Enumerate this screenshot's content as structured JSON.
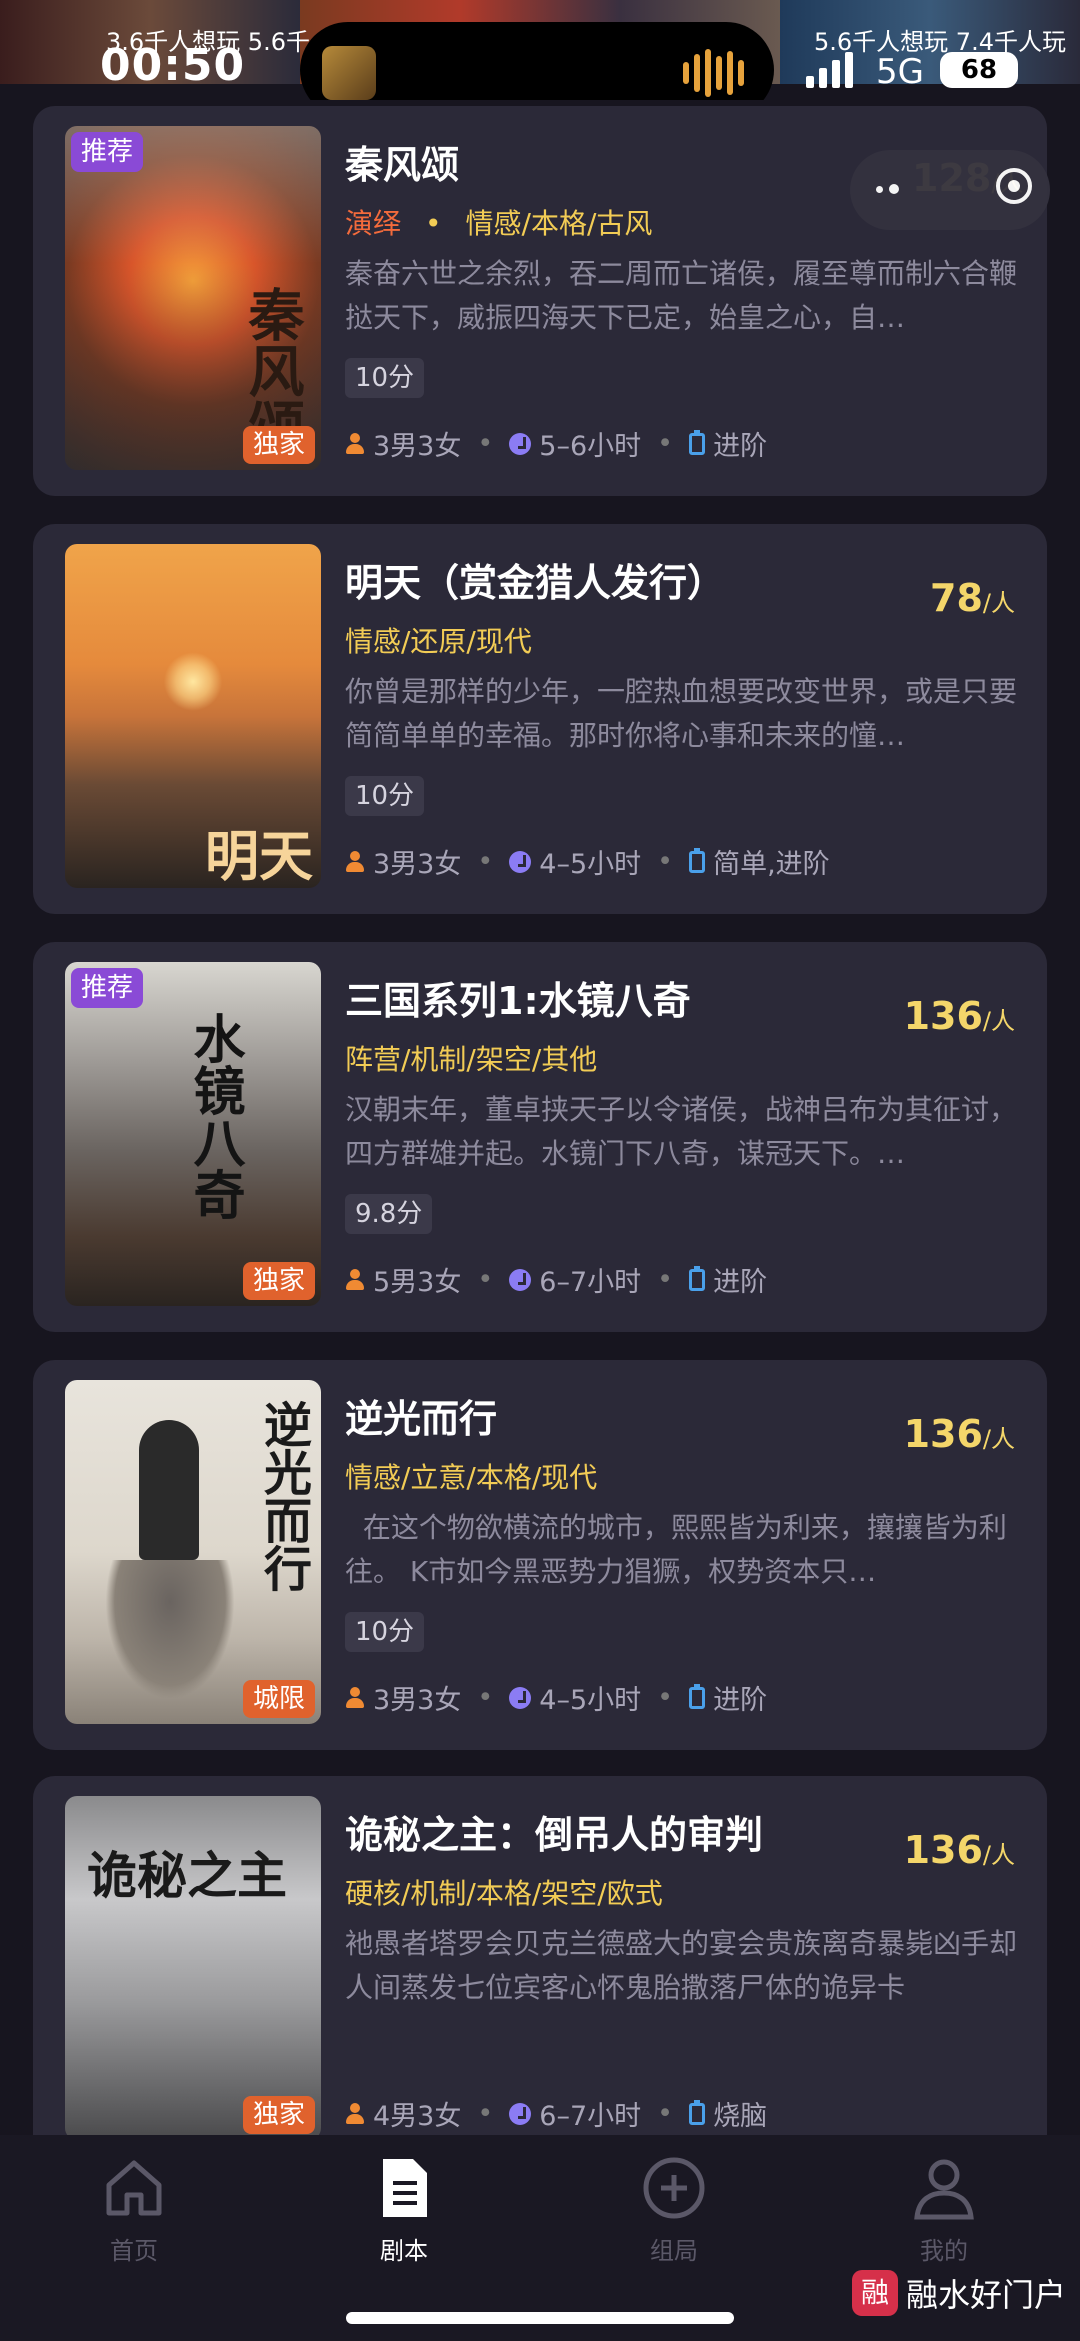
{
  "status": {
    "strip_texts": [
      "3.6千人想玩 5.6千",
      "5.6千人想玩 7.4千人玩"
    ],
    "time": "00:50",
    "network": "5G",
    "battery": "68"
  },
  "cards": [
    {
      "title": "秦风颂",
      "price": "128",
      "price_unit": "/人",
      "type": "演绎",
      "genres": "情感/本格/古风",
      "description": "秦奋六世之余烈，吞二周而亡诸侯，履至尊而制六合鞭挞天下，威振四海天下已定，始皇之心，自…",
      "score": "10分",
      "players": "3男3女",
      "duration": "5–6小时",
      "difficulty": "进阶",
      "badge_top": "推荐",
      "badge_bottom": "独家",
      "cover_title": "秦风颂"
    },
    {
      "title": "明天（赏金猎人发行）",
      "price": "78",
      "price_unit": "/人",
      "type": "",
      "genres": "情感/还原/现代",
      "description": "你曾是那样的少年，一腔热血想要改变世界，或是只要简简单单的幸福。那时你将心事和未来的憧…",
      "score": "10分",
      "players": "3男3女",
      "duration": "4–5小时",
      "difficulty": "简单,进阶",
      "badge_top": "",
      "badge_bottom": "",
      "cover_title": "明天"
    },
    {
      "title": "三国系列1:水镜八奇",
      "price": "136",
      "price_unit": "/人",
      "type": "",
      "genres": "阵营/机制/架空/其他",
      "description": "汉朝末年，董卓挟天子以令诸侯，战神吕布为其征讨，四方群雄并起。水镜门下八奇，谋冠天下。…",
      "score": "9.8分",
      "players": "5男3女",
      "duration": "6–7小时",
      "difficulty": "进阶",
      "badge_top": "推荐",
      "badge_bottom": "独家",
      "cover_title": "水镜八奇"
    },
    {
      "title": "逆光而行",
      "price": "136",
      "price_unit": "/人",
      "type": "",
      "genres": "情感/立意/本格/现代",
      "description": "  在这个物欲横流的城市，熙熙皆为利来，攘攘皆为利往。 K市如今黑恶势力猖獗，权势资本只…",
      "score": "10分",
      "players": "3男3女",
      "duration": "4–5小时",
      "difficulty": "进阶",
      "badge_top": "",
      "badge_bottom": "城限",
      "cover_title": "逆光而行"
    },
    {
      "title": "诡秘之主：倒吊人的审判",
      "price": "136",
      "price_unit": "/人",
      "type": "",
      "genres": "硬核/机制/本格/架空/欧式",
      "description": "衪愚者塔罗会贝克兰德盛大的宴会贵族离奇暴毙凶手却人间蒸发七位宾客心怀鬼胎撒落尸体的诡异卡",
      "score": "",
      "players": "4男3女",
      "duration": "6–7小时",
      "difficulty": "烧脑",
      "badge_top": "",
      "badge_bottom": "独家",
      "cover_title": "诡秘之主"
    }
  ],
  "tabs": [
    {
      "label": "首页",
      "icon": "home-icon"
    },
    {
      "label": "剧本",
      "icon": "script-icon"
    },
    {
      "label": "组局",
      "icon": "add-circle-icon"
    },
    {
      "label": "我的",
      "icon": "profile-icon"
    }
  ],
  "watermark": {
    "logo": "融",
    "text": "融水好门户"
  },
  "colors": {
    "background": "#17151f",
    "card": "#2b2938",
    "price": "#f4d66a",
    "genre": "#f2cc55",
    "type": "#f36b3c",
    "badge_top": "#8a4ad6",
    "badge_bottom": "#e0622d"
  }
}
